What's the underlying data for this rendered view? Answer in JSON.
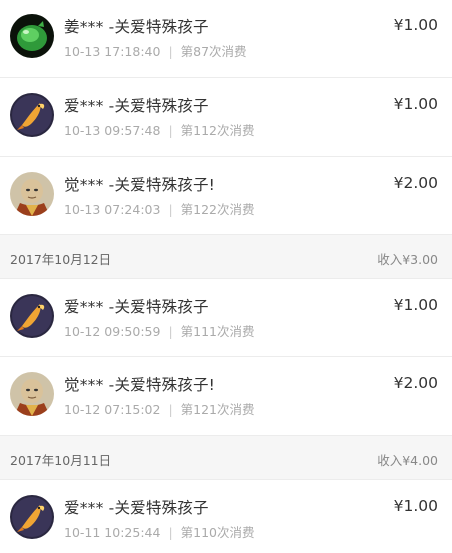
{
  "records": [
    {
      "avatar": "green-jade-avatar",
      "title": "姜*** -关爱特殊孩子",
      "time": "10-13 17:18:40",
      "count": "第87次消费",
      "amount": "¥1.00"
    },
    {
      "avatar": "koi-fish-avatar",
      "title": "爱*** -关爱特殊孩子",
      "time": "10-13 09:57:48",
      "count": "第112次消费",
      "amount": "¥1.00"
    },
    {
      "avatar": "monk-avatar",
      "title": "觉*** -关爱特殊孩子!",
      "time": "10-13 07:24:03",
      "count": "第122次消费",
      "amount": "¥2.00"
    },
    {
      "avatar": "koi-fish-avatar",
      "title": "爱*** -关爱特殊孩子",
      "time": "10-12 09:50:59",
      "count": "第111次消费",
      "amount": "¥1.00"
    },
    {
      "avatar": "monk-avatar",
      "title": "觉*** -关爱特殊孩子!",
      "time": "10-12 07:15:02",
      "count": "第121次消费",
      "amount": "¥2.00"
    },
    {
      "avatar": "koi-fish-avatar",
      "title": "爱*** -关爱特殊孩子",
      "time": "10-11 10:25:44",
      "count": "第110次消费",
      "amount": "¥1.00"
    }
  ],
  "date_groups": [
    {
      "date": "2017年10月12日",
      "income": "收入¥3.00"
    },
    {
      "date": "2017年10月11日",
      "income": "收入¥4.00"
    }
  ],
  "colors": {
    "background": "#ffffff",
    "header_bg": "#f6f6f6",
    "divider": "#ececec",
    "meta_text": "#aaaaaa"
  }
}
